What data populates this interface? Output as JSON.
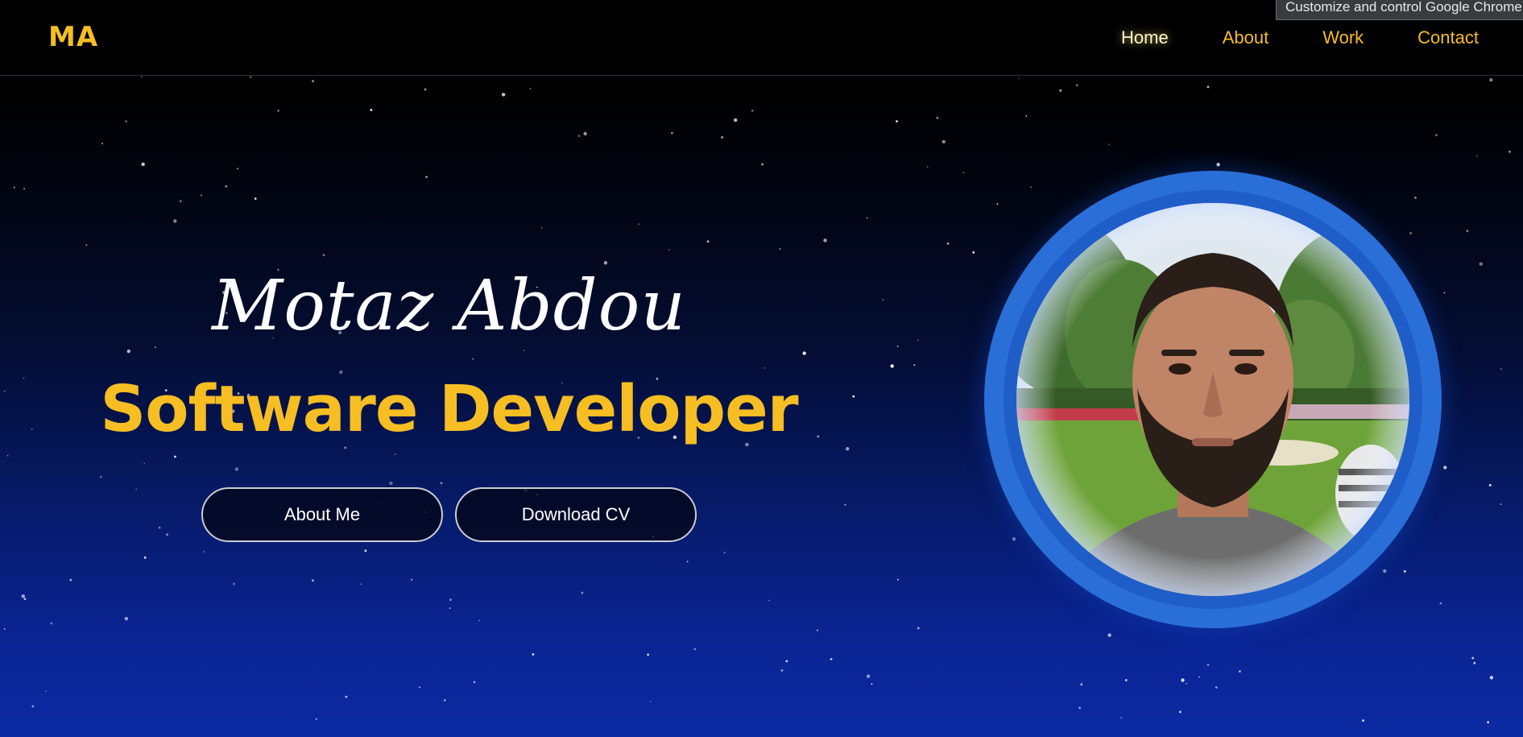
{
  "navbar": {
    "logo": "MA",
    "links": [
      {
        "label": "Home",
        "active": true
      },
      {
        "label": "About",
        "active": false
      },
      {
        "label": "Work",
        "active": false
      },
      {
        "label": "Contact",
        "active": false
      }
    ]
  },
  "tooltip": "Customize and control Google Chrome",
  "hero": {
    "name": "Motaz Abdou",
    "title": "Software Developer",
    "buttons": {
      "about": "About Me",
      "cv": "Download CV"
    }
  },
  "avatar": {
    "icon": "profile-photo"
  },
  "colors": {
    "accent": "#f6be23",
    "background_top": "#000000",
    "background_bottom": "#0b2aa3",
    "ring": "#2a6fd8"
  }
}
